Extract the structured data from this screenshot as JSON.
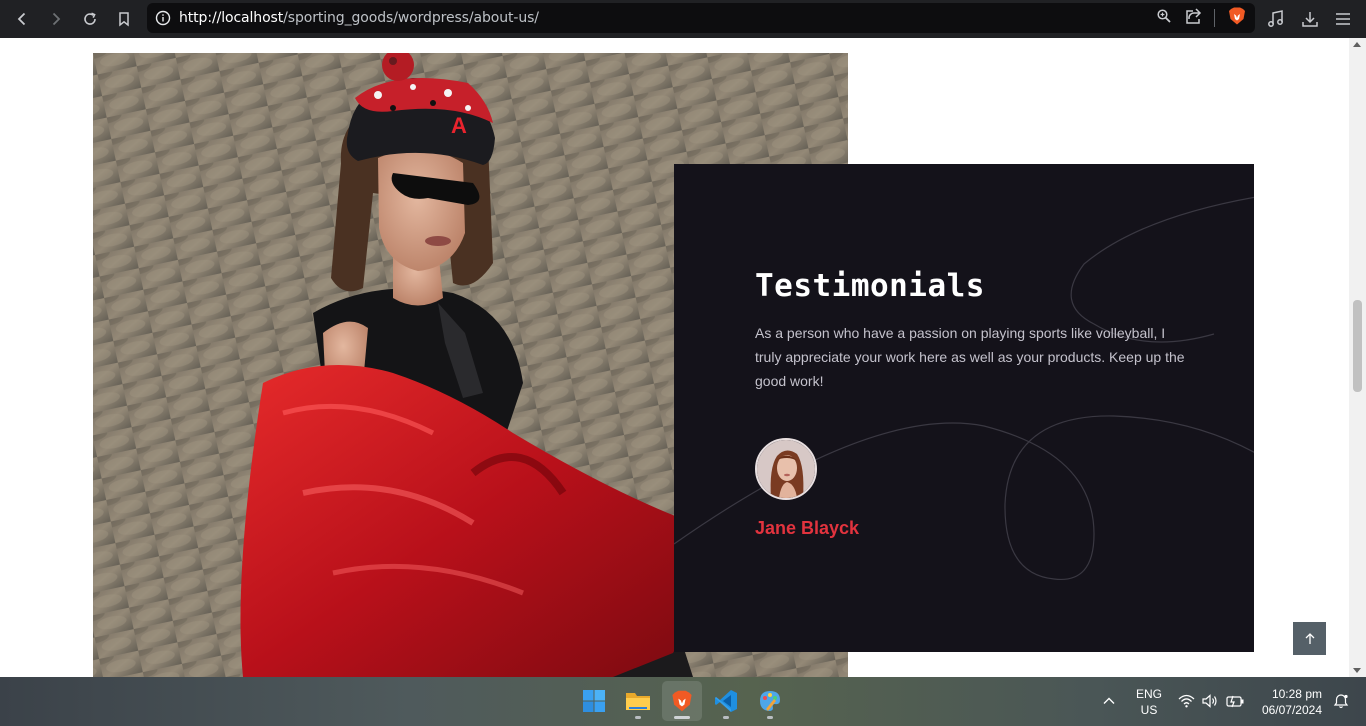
{
  "browser": {
    "url_host": "http://localhost",
    "url_path": "/sporting_goods/wordpress/about-us/",
    "icons": [
      "back-icon",
      "forward-icon",
      "reload-icon",
      "bookmark-icon",
      "info-icon",
      "zoom-icon",
      "share-icon",
      "brave-shields-icon",
      "music-icon",
      "download-icon",
      "menu-icon"
    ]
  },
  "testimonial": {
    "title": "Testimonials",
    "quote": "As a person who have a passion on playing sports like volleyball, I truly appreciate your work here as well as your products. Keep up the good work!",
    "author": "Jane Blayck"
  },
  "colors": {
    "card_bg": "#14121a",
    "author": "#e2333e",
    "scroll_top_bg": "#556068"
  },
  "taskbar": {
    "apps": [
      "windows-start-icon",
      "file-explorer-icon",
      "brave-browser-icon",
      "vscode-icon",
      "paint-icon"
    ],
    "lang_line1": "ENG",
    "lang_line2": "US",
    "time": "10:28 pm",
    "date": "06/07/2024"
  }
}
